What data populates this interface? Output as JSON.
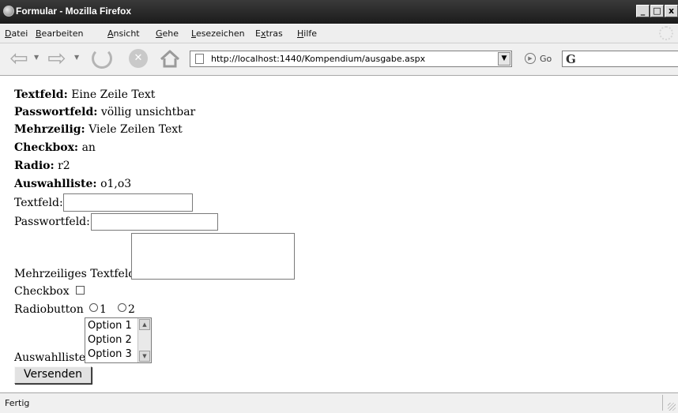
{
  "window": {
    "title": "Formular - Mozilla Firefox",
    "controls": [
      "_",
      "□",
      "x"
    ]
  },
  "menubar": {
    "items": [
      {
        "accel": "D",
        "rest": "atei"
      },
      {
        "accel": "B",
        "rest": "earbeiten"
      },
      {
        "accel": "A",
        "rest": "nsicht"
      },
      {
        "accel": "G",
        "rest": "ehe"
      },
      {
        "accel": "L",
        "rest": "esezeichen"
      },
      {
        "pre": "E",
        "accel": "x",
        "rest": "tras"
      },
      {
        "accel": "H",
        "rest": "ilfe"
      }
    ]
  },
  "navbar": {
    "url": "http://localhost:1440/Kompendium/ausgabe.aspx",
    "go_label": "Go",
    "search_glyph": "G"
  },
  "page": {
    "output": [
      {
        "label": "Textfeld:",
        "value": "Eine Zeile Text"
      },
      {
        "label": "Passwortfeld:",
        "value": "völlig unsichtbar"
      },
      {
        "label": "Mehrzeilig:",
        "value": "Viele Zeilen Text"
      },
      {
        "label": "Checkbox:",
        "value": "an"
      },
      {
        "label": "Radio:",
        "value": "r2"
      },
      {
        "label": "Auswahlliste:",
        "value": "o1,o3"
      }
    ],
    "form": {
      "textfeld_label": "Textfeld:",
      "textfeld_value": "",
      "passwort_label": "Passwortfeld:",
      "passwort_value": "",
      "textarea_label": "Mehrzeiliges Textfeld",
      "textarea_value": "",
      "checkbox_label": "Checkbox",
      "checkbox_checked": false,
      "radio_label": "Radiobutton",
      "radio_options": [
        "1",
        "2"
      ],
      "list_label": "Auswahlliste",
      "list_options": [
        "Option 1",
        "Option 2",
        "Option 3"
      ],
      "submit_label": "Versenden"
    }
  },
  "statusbar": {
    "text": "Fertig"
  }
}
